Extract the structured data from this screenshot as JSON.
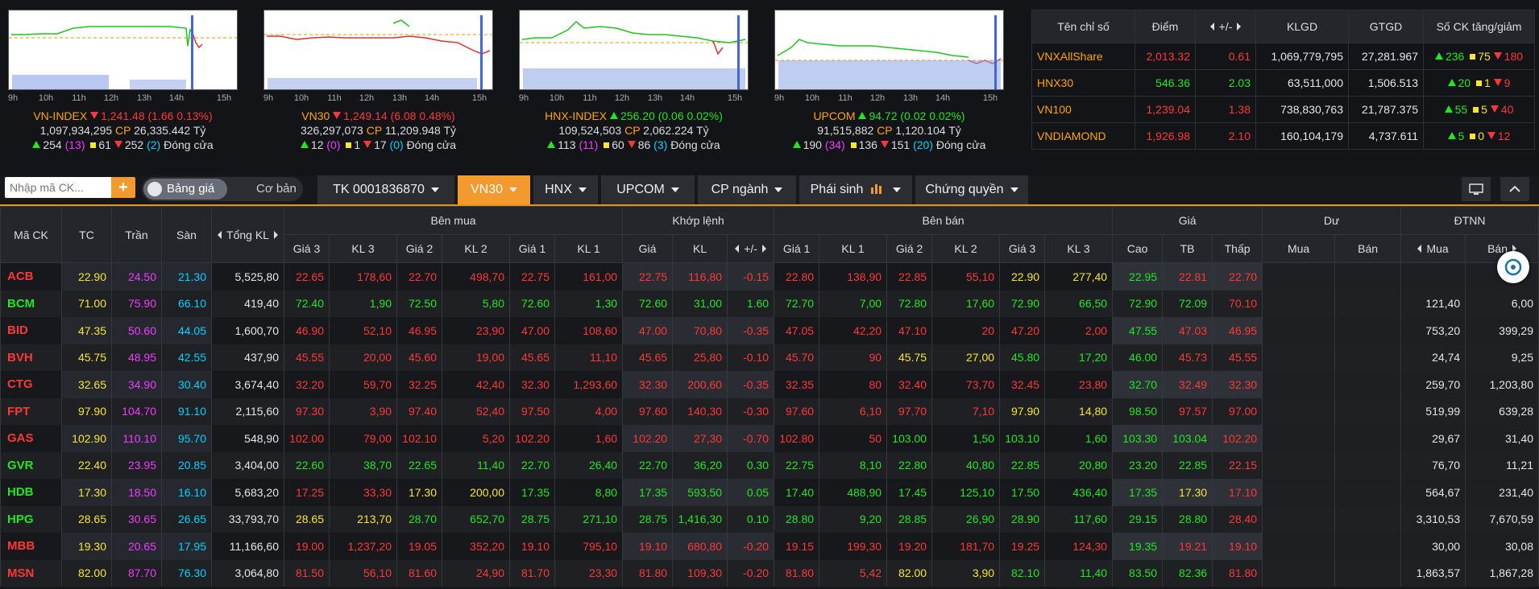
{
  "mini_charts": [
    {
      "name": "VN-INDEX",
      "value": "1,241.48",
      "change": "(1.66 0.13%)",
      "dir": "down",
      "volume": "1,097,934,295",
      "cp_label": "CP",
      "value_traded": "26,335.442 Tỷ",
      "up": "254",
      "ceil": "(13)",
      "ref": "61",
      "down": "252",
      "floor": "(2)",
      "status": "Đóng cửa"
    },
    {
      "name": "VN30",
      "value": "1,249.14",
      "change": "(6.08 0.48%)",
      "dir": "down",
      "volume": "326,297,073",
      "cp_label": "CP",
      "value_traded": "11,209.948 Tỷ",
      "up": "12",
      "ceil": "(0)",
      "ref": "1",
      "down": "17",
      "floor": "(0)",
      "status": "Đóng cửa"
    },
    {
      "name": "HNX-INDEX",
      "value": "256.20",
      "change": "(0.06 0.02%)",
      "dir": "up",
      "volume": "109,524,503",
      "cp_label": "CP",
      "value_traded": "2,062.224 Tỷ",
      "up": "113",
      "ceil": "(11)",
      "ref": "60",
      "down": "86",
      "floor": "(3)",
      "status": "Đóng cửa"
    },
    {
      "name": "UPCOM",
      "value": "94.72",
      "change": "(0.02 0.02%)",
      "dir": "up",
      "volume": "91,515,882",
      "cp_label": "CP",
      "value_traded": "1,120.104 Tỷ",
      "up": "190",
      "ceil": "(34)",
      "ref": "136",
      "down": "151",
      "floor": "(20)",
      "status": "Đóng cửa"
    }
  ],
  "hours": [
    "9h",
    "10h",
    "11h",
    "12h",
    "13h",
    "14h",
    "15h"
  ],
  "index_table": {
    "headers": {
      "name": "Tên chỉ số",
      "point": "Điểm",
      "change": "+/-",
      "klgd": "KLGD",
      "gtgd": "GTGD",
      "count": "Số CK tăng/giảm"
    },
    "rows": [
      {
        "name": "VNXAllShare",
        "point": "2,013.32",
        "change": "0.61",
        "klgd": "1,069,779,795",
        "gtgd": "27,281.967",
        "up": "236",
        "ref": "75",
        "down": "180",
        "color": "#ff3737"
      },
      {
        "name": "HNX30",
        "point": "546.36",
        "change": "2.03",
        "klgd": "63,511,000",
        "gtgd": "1,506.513",
        "up": "20",
        "ref": "1",
        "down": "9",
        "color": "#21e621"
      },
      {
        "name": "VN100",
        "point": "1,239.04",
        "change": "1.38",
        "klgd": "738,830,763",
        "gtgd": "21,787.375",
        "up": "55",
        "ref": "5",
        "down": "40",
        "color": "#ff3737"
      },
      {
        "name": "VNDIAMOND",
        "point": "1,926.98",
        "change": "2.10",
        "klgd": "160,104,179",
        "gtgd": "4,737.611",
        "up": "5",
        "ref": "0",
        "down": "12",
        "color": "#ff3737"
      }
    ]
  },
  "toolbar": {
    "search_placeholder": "Nhập mã CK...",
    "plus_label": "+",
    "toggle_on": "Bảng giá",
    "toggle_off": "Cơ bản",
    "tabs": [
      "TK 0001836870",
      "VN30",
      "HNX",
      "UPCOM",
      "CP ngành",
      "Phái sinh",
      "Chứng quyền"
    ]
  },
  "grid": {
    "groups": {
      "sym": "Mã CK",
      "tc": "TC",
      "ce": "Trần",
      "fl": "Sàn",
      "total": "Tổng KL",
      "buy": "Bên mua",
      "match": "Khớp lệnh",
      "sell": "Bên bán",
      "price": "Giá",
      "du": "Dư",
      "foreign": "ĐTNN"
    },
    "sub": {
      "g3": "Giá 3",
      "k3": "KL 3",
      "g2": "Giá 2",
      "k2": "KL 2",
      "g1": "Giá 1",
      "k1": "KL 1",
      "mp": "Giá",
      "mv": "KL",
      "mc": "+/-",
      "s1": "Giá 1",
      "sk1": "KL 1",
      "s2": "Giá 2",
      "sk2": "KL 2",
      "s3": "Giá 3",
      "sk3": "KL 3",
      "hi": "Cao",
      "avg": "TB",
      "lo": "Thấp",
      "dbuy": "Mua",
      "dsell": "Bán",
      "fbuy": "Mua",
      "fsell": "Bán"
    },
    "rows": [
      {
        "sym": "ACB",
        "tc": "22.90",
        "ce": "24.50",
        "fl": "21.30",
        "total": "5,525,80",
        "b3": "22.65",
        "bk3": "178,60",
        "b2": "22.70",
        "bk2": "498,70",
        "b1": "22.75",
        "bk1": "161,00",
        "mp": "22.75",
        "mv": "116,80",
        "mc": "-0.15",
        "s1": "22.80",
        "sk1": "138,90",
        "s2": "22.85",
        "sk2": "55,10",
        "s3": "22.90",
        "sk3": "277,40",
        "hi": "22.95",
        "avg": "22.81",
        "lo": "22.70",
        "dbuy": "",
        "dsell": "",
        "fbuy": "",
        "fsell": "",
        "cs": "r",
        "cb3": "r",
        "cb2": "r",
        "cb1": "r",
        "cm": "r",
        "cs1": "r",
        "cs2": "r",
        "cs3": "y",
        "chi": "g",
        "cavg": "r",
        "clo": "r"
      },
      {
        "sym": "BCM",
        "tc": "71.00",
        "ce": "75.90",
        "fl": "66.10",
        "total": "419,40",
        "b3": "72.40",
        "bk3": "1,90",
        "b2": "72.50",
        "bk2": "5,80",
        "b1": "72.60",
        "bk1": "1,30",
        "mp": "72.60",
        "mv": "31,00",
        "mc": "1.60",
        "s1": "72.70",
        "sk1": "7,00",
        "s2": "72.80",
        "sk2": "17,60",
        "s3": "72.90",
        "sk3": "66,50",
        "hi": "72.90",
        "avg": "72.09",
        "lo": "70.10",
        "dbuy": "",
        "dsell": "",
        "fbuy": "121,40",
        "fsell": "6,00",
        "cs": "g",
        "cb3": "g",
        "cb2": "g",
        "cb1": "g",
        "cm": "g",
        "cs1": "g",
        "cs2": "g",
        "cs3": "g",
        "chi": "g",
        "cavg": "g",
        "clo": "r"
      },
      {
        "sym": "BID",
        "tc": "47.35",
        "ce": "50.60",
        "fl": "44.05",
        "total": "1,600,70",
        "b3": "46.90",
        "bk3": "52,10",
        "b2": "46.95",
        "bk2": "23,90",
        "b1": "47.00",
        "bk1": "108,60",
        "mp": "47.00",
        "mv": "70,80",
        "mc": "-0.35",
        "s1": "47.05",
        "sk1": "42,20",
        "s2": "47.10",
        "sk2": "20",
        "s3": "47.20",
        "sk3": "2,00",
        "hi": "47.55",
        "avg": "47.03",
        "lo": "46.95",
        "dbuy": "",
        "dsell": "",
        "fbuy": "753,20",
        "fsell": "399,29",
        "cs": "r",
        "cb3": "r",
        "cb2": "r",
        "cb1": "r",
        "cm": "r",
        "cs1": "r",
        "cs2": "r",
        "cs3": "r",
        "chi": "g",
        "cavg": "r",
        "clo": "r"
      },
      {
        "sym": "BVH",
        "tc": "45.75",
        "ce": "48.95",
        "fl": "42.55",
        "total": "437,90",
        "b3": "45.55",
        "bk3": "20,00",
        "b2": "45.60",
        "bk2": "19,00",
        "b1": "45.65",
        "bk1": "11,10",
        "mp": "45.65",
        "mv": "25,80",
        "mc": "-0.10",
        "s1": "45.70",
        "sk1": "90",
        "s2": "45.75",
        "sk2": "27,00",
        "s3": "45.80",
        "sk3": "17,20",
        "hi": "46.00",
        "avg": "45.73",
        "lo": "45.55",
        "dbuy": "",
        "dsell": "",
        "fbuy": "24,74",
        "fsell": "9,25",
        "cs": "r",
        "cb3": "r",
        "cb2": "r",
        "cb1": "r",
        "cm": "r",
        "cs1": "r",
        "cs2": "y",
        "cs3": "g",
        "chi": "g",
        "cavg": "r",
        "clo": "r"
      },
      {
        "sym": "CTG",
        "tc": "32.65",
        "ce": "34.90",
        "fl": "30.40",
        "total": "3,674,40",
        "b3": "32.20",
        "bk3": "59,70",
        "b2": "32.25",
        "bk2": "42,40",
        "b1": "32.30",
        "bk1": "1,293,60",
        "mp": "32.30",
        "mv": "200,60",
        "mc": "-0.35",
        "s1": "32.35",
        "sk1": "80",
        "s2": "32.40",
        "sk2": "73,70",
        "s3": "32.45",
        "sk3": "23,80",
        "hi": "32.70",
        "avg": "32.49",
        "lo": "32.30",
        "dbuy": "",
        "dsell": "",
        "fbuy": "259,70",
        "fsell": "1,203,80",
        "cs": "r",
        "cb3": "r",
        "cb2": "r",
        "cb1": "r",
        "cm": "r",
        "cs1": "r",
        "cs2": "r",
        "cs3": "r",
        "chi": "g",
        "cavg": "r",
        "clo": "r"
      },
      {
        "sym": "FPT",
        "tc": "97.90",
        "ce": "104.70",
        "fl": "91.10",
        "total": "2,115,60",
        "b3": "97.30",
        "bk3": "3,90",
        "b2": "97.40",
        "bk2": "52,40",
        "b1": "97.50",
        "bk1": "4,00",
        "mp": "97.60",
        "mv": "140,30",
        "mc": "-0.30",
        "s1": "97.60",
        "sk1": "6,10",
        "s2": "97.70",
        "sk2": "7,10",
        "s3": "97.90",
        "sk3": "14,80",
        "hi": "98.50",
        "avg": "97.57",
        "lo": "97.00",
        "dbuy": "",
        "dsell": "",
        "fbuy": "519,99",
        "fsell": "639,28",
        "cs": "r",
        "cb3": "r",
        "cb2": "r",
        "cb1": "r",
        "cm": "r",
        "cs1": "r",
        "cs2": "r",
        "cs3": "y",
        "chi": "g",
        "cavg": "r",
        "clo": "r"
      },
      {
        "sym": "GAS",
        "tc": "102.90",
        "ce": "110.10",
        "fl": "95.70",
        "total": "548,90",
        "b3": "102.00",
        "bk3": "79,00",
        "b2": "102.10",
        "bk2": "5,20",
        "b1": "102.20",
        "bk1": "1,60",
        "mp": "102.20",
        "mv": "27,30",
        "mc": "-0.70",
        "s1": "102.80",
        "sk1": "50",
        "s2": "103.00",
        "sk2": "1,50",
        "s3": "103.10",
        "sk3": "1,60",
        "hi": "103.30",
        "avg": "103.04",
        "lo": "102.20",
        "dbuy": "",
        "dsell": "",
        "fbuy": "29,67",
        "fsell": "31,40",
        "cs": "r",
        "cb3": "r",
        "cb2": "r",
        "cb1": "r",
        "cm": "r",
        "cs1": "r",
        "cs2": "g",
        "cs3": "g",
        "chi": "g",
        "cavg": "g",
        "clo": "r"
      },
      {
        "sym": "GVR",
        "tc": "22.40",
        "ce": "23.95",
        "fl": "20.85",
        "total": "3,404,00",
        "b3": "22.60",
        "bk3": "38,70",
        "b2": "22.65",
        "bk2": "11,40",
        "b1": "22.70",
        "bk1": "26,40",
        "mp": "22.70",
        "mv": "36,20",
        "mc": "0.30",
        "s1": "22.75",
        "sk1": "8,10",
        "s2": "22.80",
        "sk2": "40,80",
        "s3": "22.85",
        "sk3": "20,80",
        "hi": "23.20",
        "avg": "22.85",
        "lo": "22.15",
        "dbuy": "",
        "dsell": "",
        "fbuy": "76,70",
        "fsell": "11,21",
        "cs": "g",
        "cb3": "g",
        "cb2": "g",
        "cb1": "g",
        "cm": "g",
        "cs1": "g",
        "cs2": "g",
        "cs3": "g",
        "chi": "g",
        "cavg": "g",
        "clo": "r"
      },
      {
        "sym": "HDB",
        "tc": "17.30",
        "ce": "18.50",
        "fl": "16.10",
        "total": "5,683,20",
        "b3": "17.25",
        "bk3": "33,30",
        "b2": "17.30",
        "bk2": "200,00",
        "b1": "17.35",
        "bk1": "8,80",
        "mp": "17.35",
        "mv": "593,50",
        "mc": "0.05",
        "s1": "17.40",
        "sk1": "488,90",
        "s2": "17.45",
        "sk2": "125,10",
        "s3": "17.50",
        "sk3": "436,40",
        "hi": "17.35",
        "avg": "17.30",
        "lo": "17.10",
        "dbuy": "",
        "dsell": "",
        "fbuy": "564,67",
        "fsell": "231,40",
        "cs": "g",
        "cb3": "r",
        "cb2": "y",
        "cb1": "g",
        "cm": "g",
        "cs1": "g",
        "cs2": "g",
        "cs3": "g",
        "chi": "g",
        "cavg": "y",
        "clo": "r"
      },
      {
        "sym": "HPG",
        "tc": "28.65",
        "ce": "30.65",
        "fl": "26.65",
        "total": "33,793,70",
        "b3": "28.65",
        "bk3": "213,70",
        "b2": "28.70",
        "bk2": "652,70",
        "b1": "28.75",
        "bk1": "271,10",
        "mp": "28.75",
        "mv": "1,416,30",
        "mc": "0.10",
        "s1": "28.80",
        "sk1": "9,20",
        "s2": "28.85",
        "sk2": "26,90",
        "s3": "28.90",
        "sk3": "117,60",
        "hi": "29.15",
        "avg": "28.80",
        "lo": "28.40",
        "dbuy": "",
        "dsell": "",
        "fbuy": "3,310,53",
        "fsell": "7,670,59",
        "cs": "g",
        "cb3": "y",
        "cb2": "g",
        "cb1": "g",
        "cm": "g",
        "cs1": "g",
        "cs2": "g",
        "cs3": "g",
        "chi": "g",
        "cavg": "g",
        "clo": "r"
      },
      {
        "sym": "MBB",
        "tc": "19.30",
        "ce": "20.65",
        "fl": "17.95",
        "total": "11,166,60",
        "b3": "19.00",
        "bk3": "1,237,20",
        "b2": "19.05",
        "bk2": "352,20",
        "b1": "19.10",
        "bk1": "795,10",
        "mp": "19.10",
        "mv": "680,80",
        "mc": "-0.20",
        "s1": "19.15",
        "sk1": "199,30",
        "s2": "19.20",
        "sk2": "181,70",
        "s3": "19.25",
        "sk3": "124,30",
        "hi": "19.35",
        "avg": "19.21",
        "lo": "19.10",
        "dbuy": "",
        "dsell": "",
        "fbuy": "30,00",
        "fsell": "30,08",
        "cs": "r",
        "cb3": "r",
        "cb2": "r",
        "cb1": "r",
        "cm": "r",
        "cs1": "r",
        "cs2": "r",
        "cs3": "r",
        "chi": "g",
        "cavg": "r",
        "clo": "r"
      },
      {
        "sym": "MSN",
        "tc": "82.00",
        "ce": "87.70",
        "fl": "76.30",
        "total": "3,064,80",
        "b3": "81.50",
        "bk3": "56,10",
        "b2": "81.60",
        "bk2": "24,90",
        "b1": "81.70",
        "bk1": "23,30",
        "mp": "81.80",
        "mv": "109,30",
        "mc": "-0.20",
        "s1": "81.80",
        "sk1": "5,42",
        "s2": "82.00",
        "sk2": "3,90",
        "s3": "82.10",
        "sk3": "11,40",
        "hi": "83.50",
        "avg": "82.36",
        "lo": "81.80",
        "dbuy": "",
        "dsell": "",
        "fbuy": "1,863,57",
        "fsell": "1,867,28",
        "cs": "r",
        "cb3": "r",
        "cb2": "r",
        "cb1": "r",
        "cm": "r",
        "cs1": "r",
        "cs2": "y",
        "cs3": "g",
        "chi": "g",
        "cavg": "g",
        "clo": "r"
      }
    ]
  },
  "colors": {
    "red": "#ff3737",
    "green": "#21e621",
    "yellow": "#f6e531",
    "purple": "#f23aff",
    "cyan": "#00d2ff",
    "orange": "#ffa500",
    "accent": "#f29a2e"
  }
}
